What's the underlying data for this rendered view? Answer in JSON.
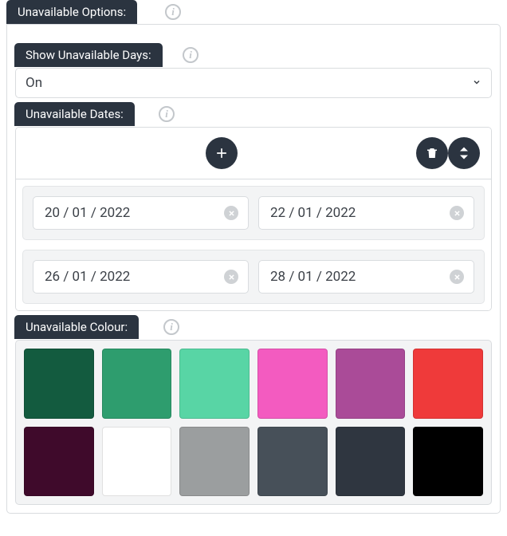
{
  "main": {
    "title": "Unavailable Options:"
  },
  "show_days": {
    "label": "Show Unavailable Days:",
    "value": "On"
  },
  "dates": {
    "label": "Unavailable Dates:",
    "rows": [
      {
        "from": "20 / 01 / 2022",
        "to": "22 / 01 / 2022"
      },
      {
        "from": "26 / 01 / 2022",
        "to": "28 / 01 / 2022"
      }
    ]
  },
  "colour": {
    "label": "Unavailable Colour:",
    "swatches": [
      "#135b3f",
      "#2e9d6e",
      "#58d5a5",
      "#f35bc0",
      "#aa4b98",
      "#ef3a3a",
      "#3f0a2b",
      "#ffffff",
      "#9b9e9f",
      "#475059",
      "#2f3640",
      "#000000"
    ]
  }
}
